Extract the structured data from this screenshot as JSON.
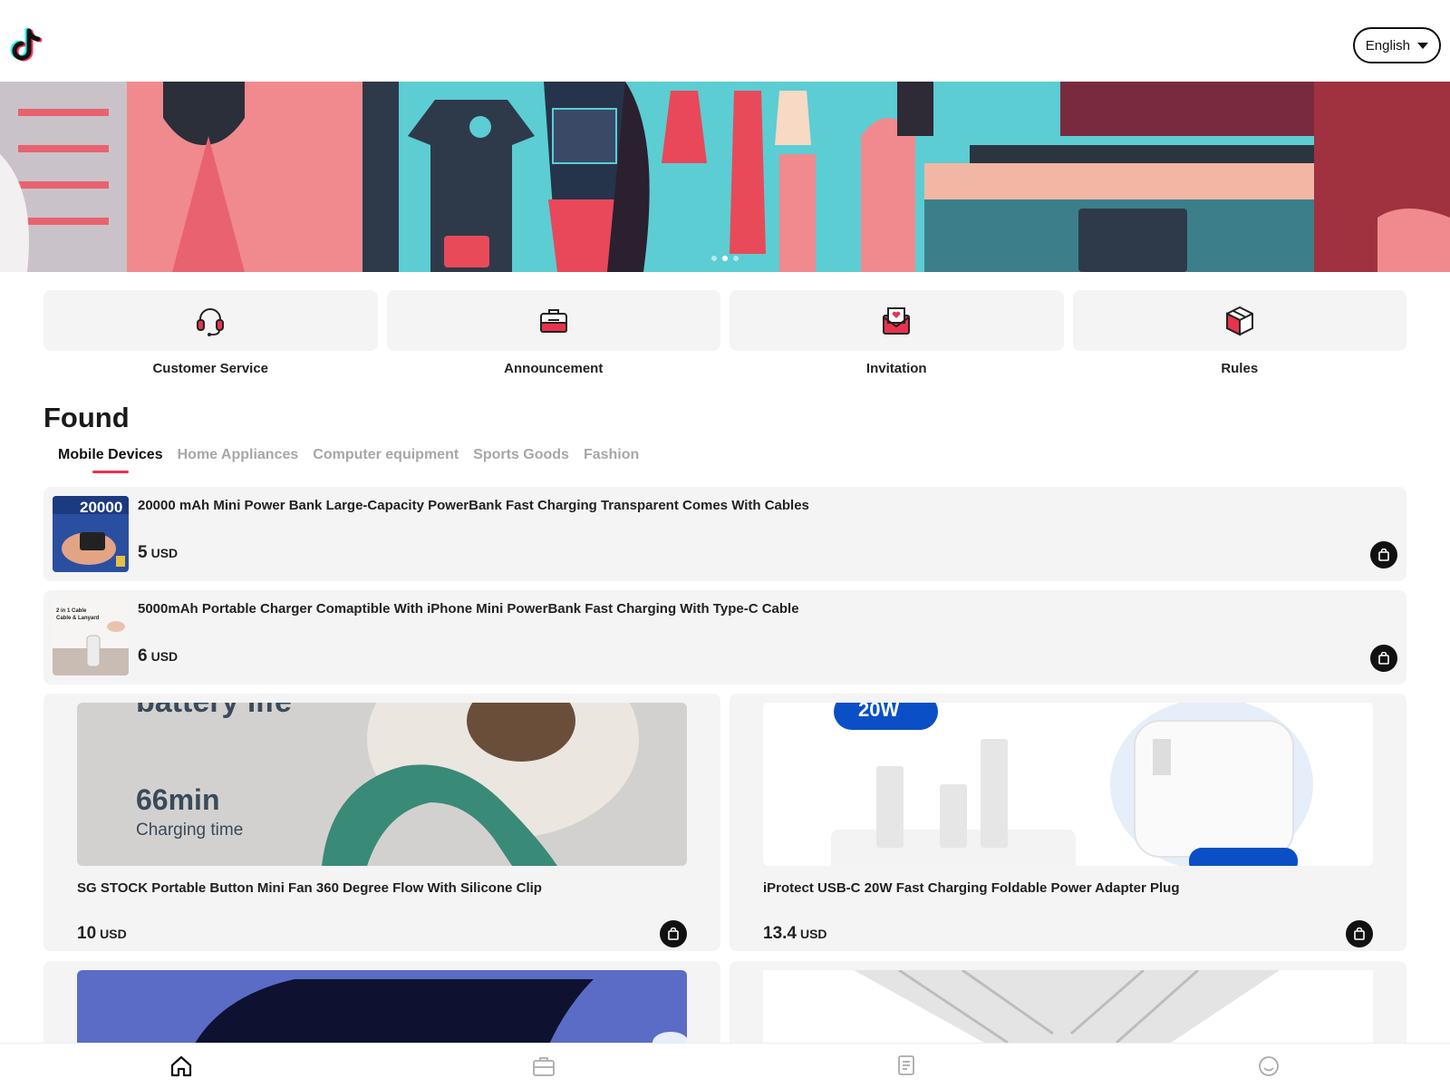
{
  "header": {
    "logo": "tiktok-logo",
    "language": "English"
  },
  "banner": {
    "slides": 3,
    "active_slide": 2
  },
  "quick_links": [
    {
      "label": "Customer Service",
      "icon": "headset-icon"
    },
    {
      "label": "Announcement",
      "icon": "briefcase-icon"
    },
    {
      "label": "Invitation",
      "icon": "mail-heart-icon"
    },
    {
      "label": "Rules",
      "icon": "box-icon"
    }
  ],
  "section": {
    "title": "Found",
    "tabs": [
      "Mobile Devices",
      "Home Appliances",
      "Computer equipment",
      "Sports Goods",
      "Fashion"
    ],
    "active_tab": "Mobile Devices"
  },
  "products": [
    {
      "title": "20000 mAh Mini Power Bank Large-Capacity PowerBank Fast Charging Transparent Comes With Cables",
      "price": "5",
      "currency": "USD",
      "thumb_text": "20000"
    },
    {
      "title": "5000mAh Portable Charger Comaptible With iPhone Mini PowerBank Fast Charging With Type-C Cable",
      "price": "6",
      "currency": "USD",
      "thumb_text": "2 in 1 Cable\nCable & Lanyard"
    },
    {
      "title": "SG STOCK Portable Button Mini Fan 360 Degree Flow With Silicone Clip",
      "price": "10",
      "currency": "USD",
      "img_top_text": "battery life",
      "img_big_text": "66min",
      "img_small_text": "Charging time"
    },
    {
      "title": "iProtect USB-C 20W Fast Charging Foldable Power Adapter Plug",
      "price": "13.4",
      "currency": "USD",
      "img_badge": "20W"
    }
  ],
  "bottom_nav": [
    {
      "icon": "home-icon",
      "active": true
    },
    {
      "icon": "briefcase-icon",
      "active": false
    },
    {
      "icon": "orders-icon",
      "active": false
    },
    {
      "icon": "profile-icon",
      "active": false
    }
  ],
  "colors": {
    "accent": "#e8334f",
    "card_bg": "#f4f4f4",
    "banner_teal": "#53c9cf",
    "banner_pink": "#e8636f"
  }
}
